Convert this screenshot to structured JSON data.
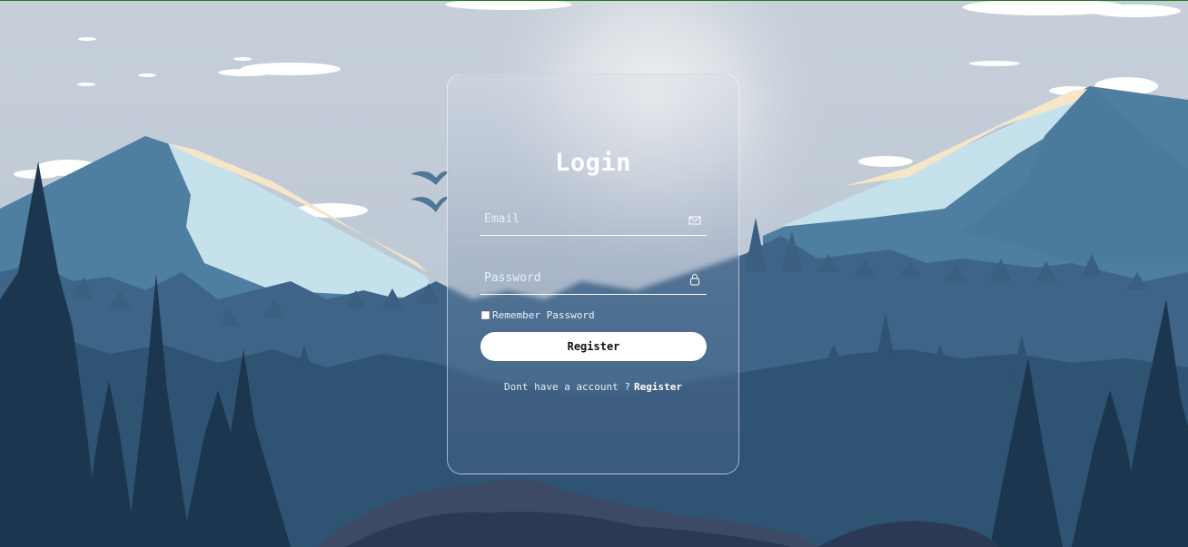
{
  "login": {
    "title": "Login",
    "email_placeholder": "Email",
    "password_placeholder": "Password",
    "remember_label": "Remember Password",
    "submit_label": "Register",
    "signup_prompt": "Dont have a account ?",
    "signup_link": "Register"
  },
  "icons": {
    "email": "envelope-icon",
    "password": "lock-icon"
  },
  "colors": {
    "sky": "#c4cdd8",
    "mountain": "#4f7fa0",
    "snow": "#c8e3ee",
    "forest_far": "#3f6688",
    "forest_near": "#1e3a55",
    "button": "#ffffff"
  }
}
